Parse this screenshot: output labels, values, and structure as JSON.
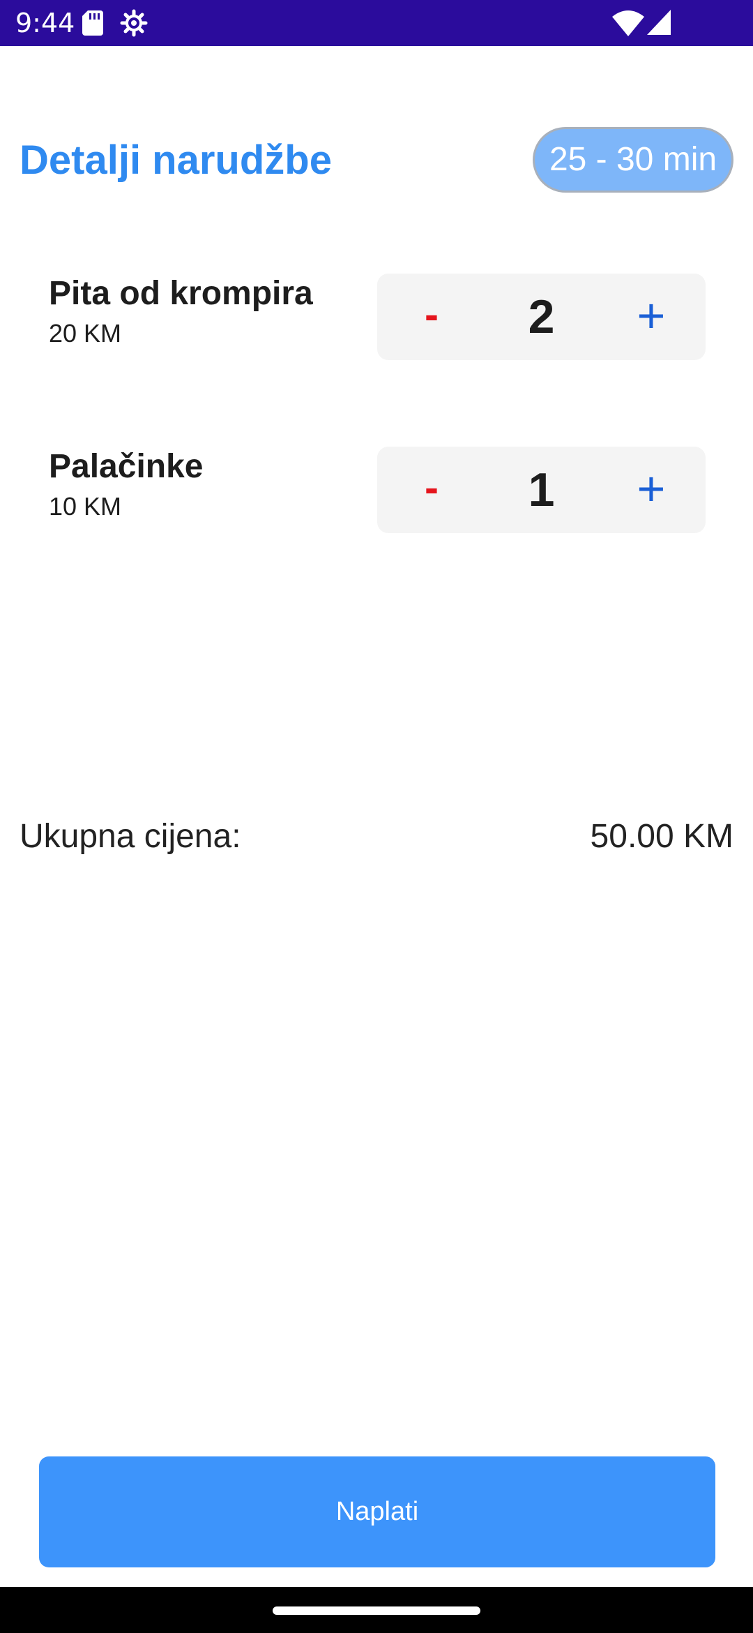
{
  "status_bar": {
    "time": "9:44",
    "icons": [
      "sd-card-icon",
      "settings-gear-icon",
      "wifi-icon",
      "cell-signal-icon"
    ],
    "background_color": "#2b0c9c"
  },
  "header": {
    "title": "Detalji narudžbe",
    "eta": "25 - 30 min"
  },
  "items": [
    {
      "name": "Pita od krompira",
      "price": "20 KM",
      "quantity": "2",
      "minus_label": "-",
      "plus_label": "+"
    },
    {
      "name": "Palačinke",
      "price": "10 KM",
      "quantity": "1",
      "minus_label": "-",
      "plus_label": "+"
    }
  ],
  "total": {
    "label": "Ukupna cijena:",
    "value": "50.00 KM"
  },
  "checkout": {
    "button_label": "Naplati"
  },
  "colors": {
    "accent": "#2f8af0",
    "button": "#3d94fb",
    "badge": "#7eb6f9",
    "minus": "#e5141c",
    "plus": "#1a5fd6"
  }
}
